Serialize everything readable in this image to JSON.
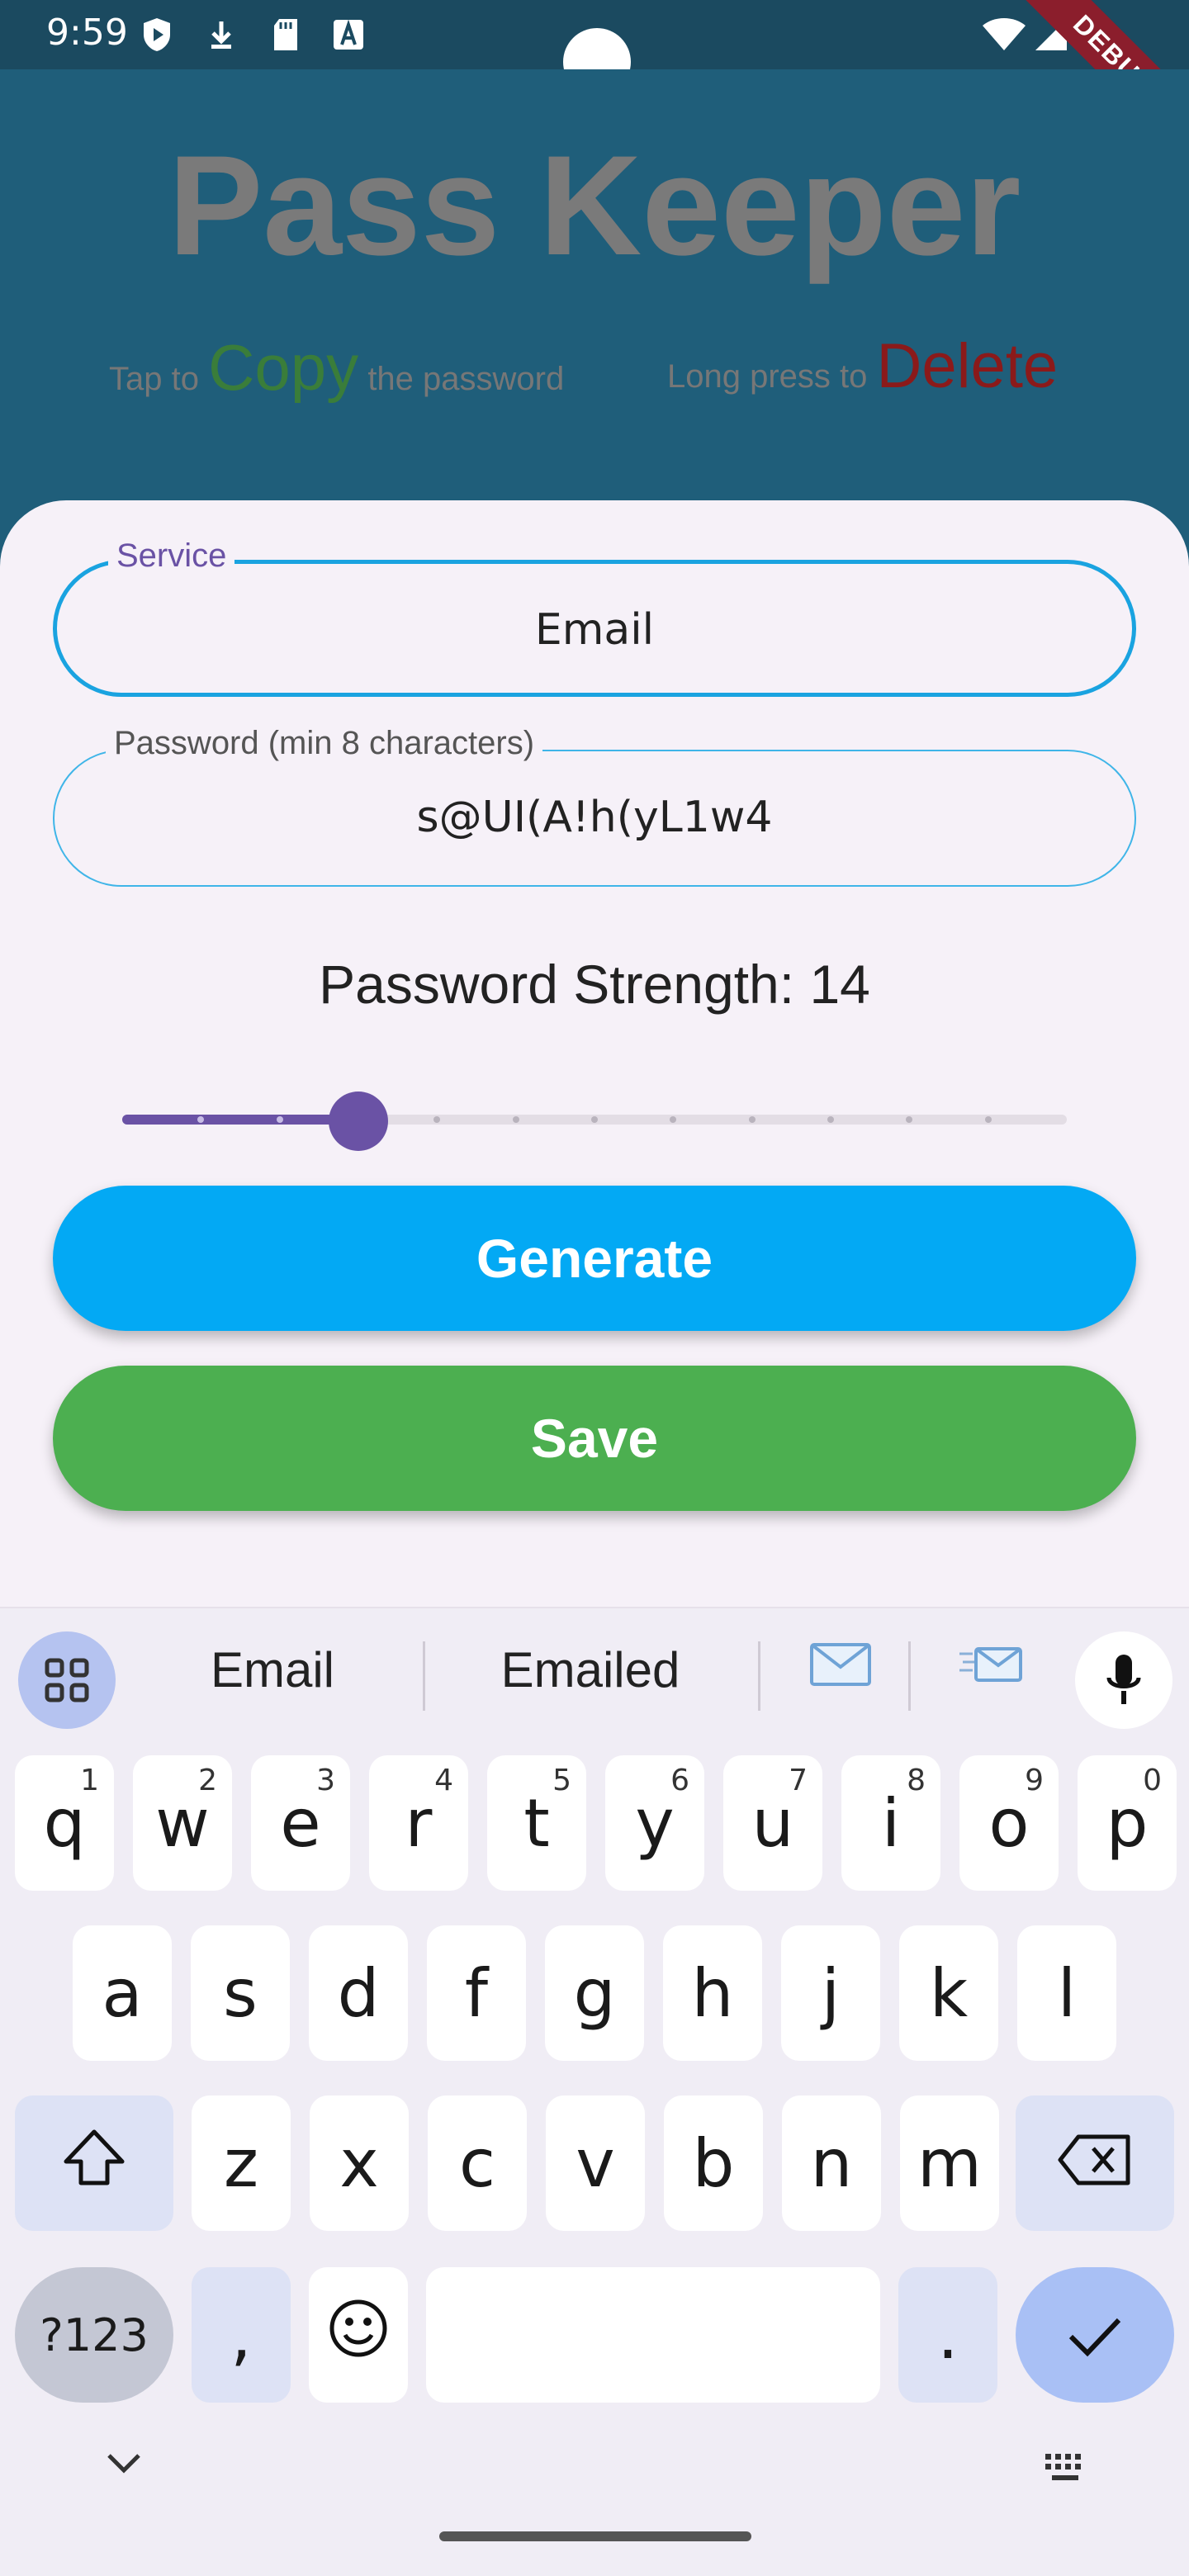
{
  "status": {
    "time": "9:59"
  },
  "debug_label": "DEBUG",
  "app": {
    "title": "Pass Keeper"
  },
  "hints": {
    "tap_prefix": "Tap to",
    "copy": "Copy",
    "tap_suffix": "the password",
    "long_prefix": "Long press to",
    "delete": "Delete"
  },
  "form": {
    "service_label": "Service",
    "service_value": "Email",
    "password_label": "Password (min 8 characters)",
    "password_value": "s@UI(A!h(yL1w4",
    "strength_prefix": "Password Strength:",
    "strength_value": "14",
    "slider": {
      "value": 14,
      "min": 8,
      "max": 32
    },
    "generate_label": "Generate",
    "save_label": "Save"
  },
  "colors": {
    "header_bg": "#1f5e7a",
    "accent_purple": "#6a52a5",
    "generate_blue": "#03a9f4",
    "save_green": "#4caf50",
    "copy_green": "#3a7d3a",
    "delete_red": "#8b1a1a"
  },
  "keyboard": {
    "suggestions": [
      "Email",
      "Emailed"
    ],
    "row1": [
      "q",
      "w",
      "e",
      "r",
      "t",
      "y",
      "u",
      "i",
      "o",
      "p"
    ],
    "row1_nums": [
      "1",
      "2",
      "3",
      "4",
      "5",
      "6",
      "7",
      "8",
      "9",
      "0"
    ],
    "row2": [
      "a",
      "s",
      "d",
      "f",
      "g",
      "h",
      "j",
      "k",
      "l"
    ],
    "row3": [
      "z",
      "x",
      "c",
      "v",
      "b",
      "n",
      "m"
    ],
    "symbols_key": "?123",
    "comma": ",",
    "period": ".",
    "icons": [
      "apps-grid-icon",
      "envelope-icon",
      "envelope-send-icon",
      "mic-icon",
      "shift-icon",
      "backspace-icon",
      "emoji-icon",
      "check-icon",
      "chevron-down-icon",
      "keyboard-icon"
    ]
  }
}
